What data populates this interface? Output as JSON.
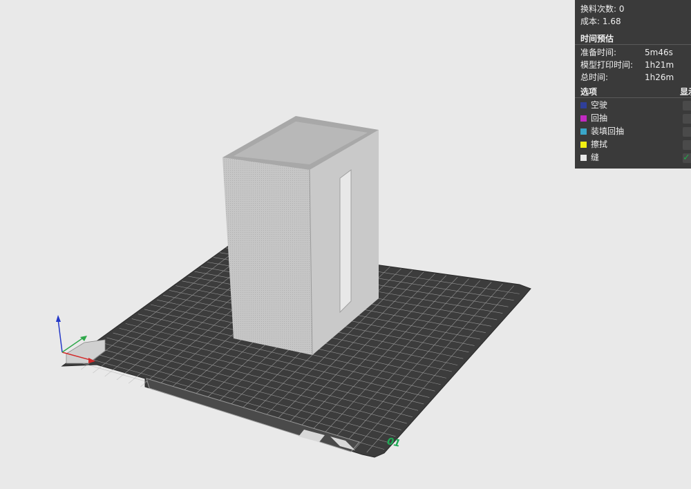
{
  "stats": {
    "filament_changes_label": "换料次数:",
    "filament_changes_value": "0",
    "cost_label": "成本:",
    "cost_value": "1.68"
  },
  "time_estimate": {
    "title": "时间预估",
    "rows": [
      {
        "label": "准备时间:",
        "value": "5m46s"
      },
      {
        "label": "模型打印时间:",
        "value": "1h21m"
      },
      {
        "label": "总时间:",
        "value": "1h26m"
      }
    ]
  },
  "options": {
    "title": "选项",
    "display_header": "显示",
    "items": [
      {
        "label": "空驶",
        "color": "#2f3f9a",
        "checked": false
      },
      {
        "label": "回抽",
        "color": "#c22ac2",
        "checked": false
      },
      {
        "label": "装填回抽",
        "color": "#3aa6c8",
        "checked": false
      },
      {
        "label": "擦拭",
        "color": "#f2ef12",
        "checked": false
      },
      {
        "label": "缝",
        "color": "#e8e8e8",
        "checked": true
      }
    ]
  },
  "viewport": {
    "plate_number": "01",
    "plate_color": "#3c3c3c",
    "grid_color": "#b5b5b5",
    "model_color": "#bdbdbd",
    "axis_colors": {
      "x": "#d22a2a",
      "y": "#2ea84a",
      "z": "#2438c8"
    }
  }
}
